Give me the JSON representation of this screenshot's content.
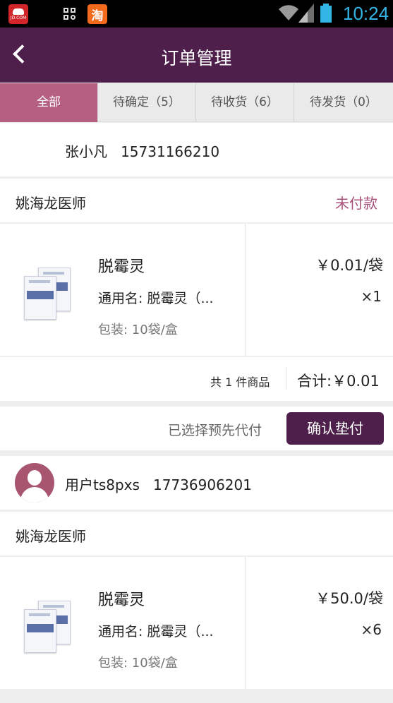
{
  "status_bar": {
    "time": "10:24",
    "apps": [
      {
        "name": "jd-app-icon",
        "label": "JD.COM"
      },
      {
        "name": "grid-app-icon",
        "label": ""
      },
      {
        "name": "taobao-app-icon",
        "label": "淘"
      }
    ],
    "accent": "#33b5e5"
  },
  "header": {
    "title": "订单管理",
    "background": "#4d1f4a"
  },
  "tabs": [
    {
      "label": "全部",
      "active": true
    },
    {
      "label": "待确定（5）",
      "active": false
    },
    {
      "label": "待收货（6）",
      "active": false
    },
    {
      "label": "待发货（0）",
      "active": false
    }
  ],
  "orders": [
    {
      "user": {
        "text": "张小凡   15731166210",
        "has_avatar": false
      },
      "doctor": "姚海龙医师",
      "status": "未付款",
      "product": {
        "name": "脱霉灵",
        "generic": "通用名: 脱霉灵（...",
        "package": "包装: 10袋/盒",
        "price": "￥0.01/袋",
        "quantity": "×1"
      },
      "summary": {
        "count": "共 1 件商品",
        "total": "合计:￥0.01"
      },
      "action": {
        "label": "已选择预先代付",
        "button": "确认垫付"
      }
    },
    {
      "user": {
        "text": "用户ts8pxs   17736906201",
        "has_avatar": true
      },
      "doctor": "姚海龙医师",
      "status": "",
      "product": {
        "name": "脱霉灵",
        "generic": "通用名: 脱霉灵（...",
        "package": "包装: 10袋/盒",
        "price": "￥50.0/袋",
        "quantity": "×6"
      }
    }
  ],
  "colors": {
    "active_tab": "#b55f83",
    "status_unpaid": "#a8507a",
    "button": "#4d1f4a"
  }
}
